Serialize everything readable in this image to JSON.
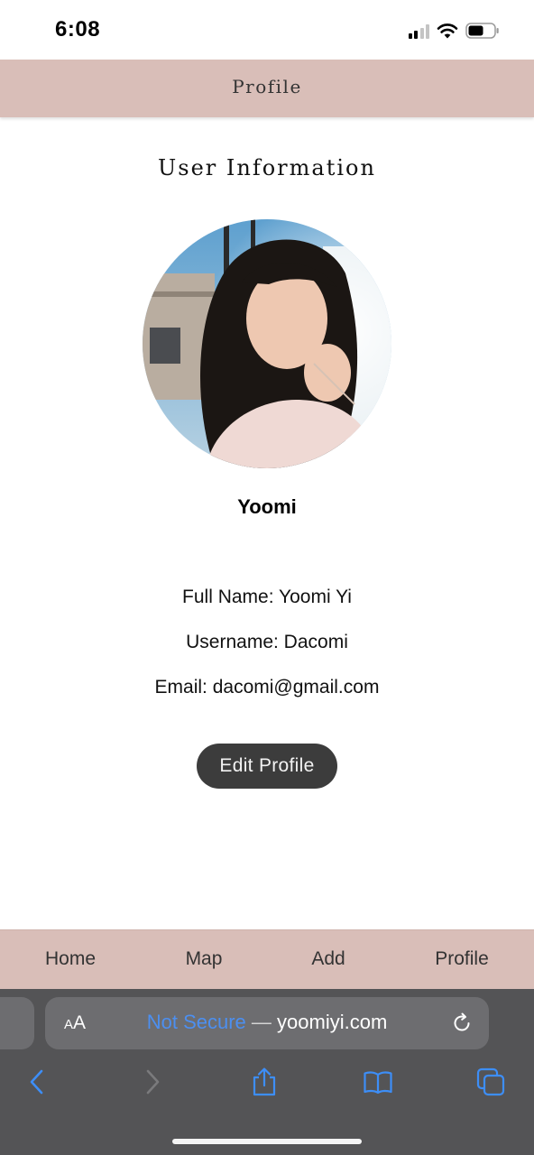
{
  "status_bar": {
    "time": "6:08"
  },
  "header": {
    "title": "Profile"
  },
  "main": {
    "section_title": "User Information",
    "display_name": "Yoomi",
    "full_name_label": "Full Name:",
    "full_name": "Yoomi Yi",
    "username_label": "Username:",
    "username": "Dacomi",
    "email_label": "Email:",
    "email": "dacomi@gmail.com",
    "edit_button": "Edit Profile"
  },
  "bottom_nav": {
    "items": [
      "Home",
      "Map",
      "Add",
      "Profile"
    ]
  },
  "browser": {
    "text_size_small": "A",
    "text_size_large": "A",
    "security_text": "Not Secure",
    "separator": "—",
    "domain": "yoomiyi.com"
  },
  "colors": {
    "header_bg": "#d9beb8",
    "button_bg": "#3c3c3c",
    "browser_link": "#4c8ff0",
    "browser_bar": "#545456"
  },
  "icons": [
    "cellular-signal-icon",
    "wifi-icon",
    "battery-icon",
    "reload-icon",
    "back-icon",
    "forward-icon",
    "share-icon",
    "bookmarks-icon",
    "tabs-icon"
  ]
}
